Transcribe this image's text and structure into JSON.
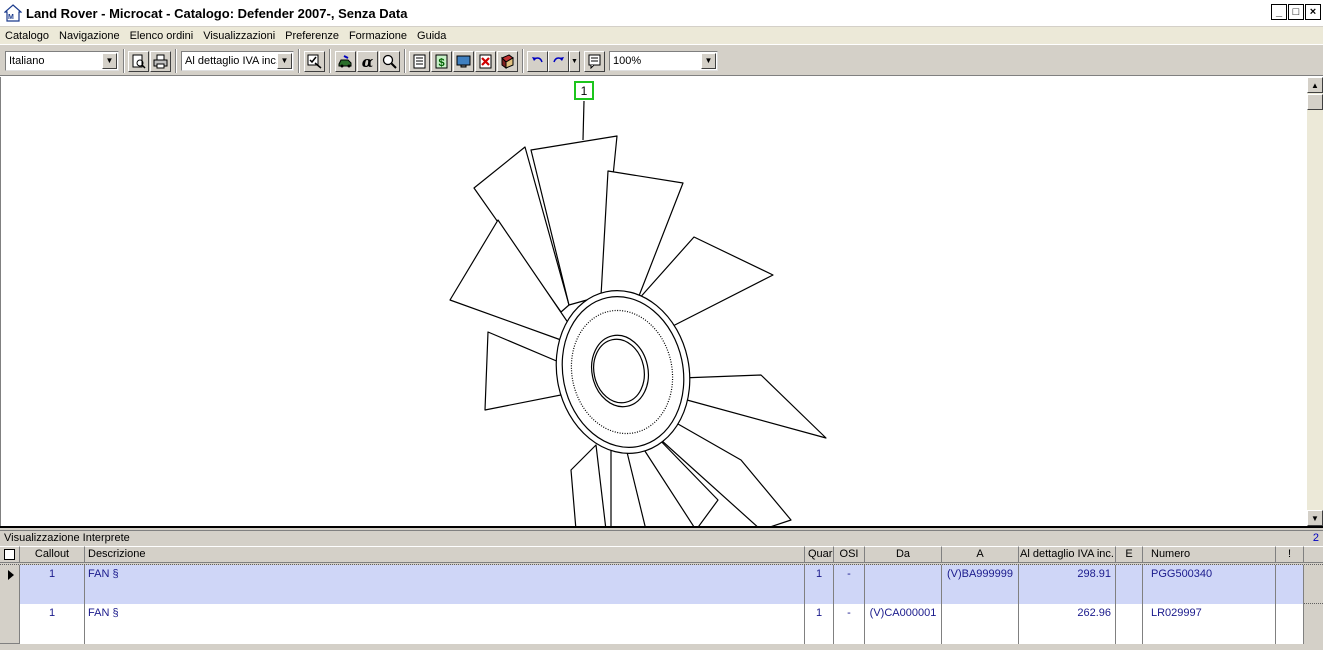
{
  "window": {
    "title": "Land Rover - Microcat - Catalogo: Defender 2007-, Senza Data",
    "minimize": "_",
    "maximize": "□",
    "close": "×"
  },
  "menu": [
    "Catalogo",
    "Navigazione",
    "Elenco ordini",
    "Visualizzazioni",
    "Preferenze",
    "Formazione",
    "Guida"
  ],
  "toolbar": {
    "language": "Italiano",
    "price_mode": "Al dettaglio IVA inc.",
    "zoom": "100%",
    "alpha_symbol": "α"
  },
  "drawing": {
    "callout_label": "1"
  },
  "panel": {
    "title": "Visualizzazione Interprete",
    "count": "2"
  },
  "table": {
    "headers": {
      "callout": "Callout",
      "descrizione": "Descrizione",
      "quantita": "Quar",
      "osi": "OSI",
      "da": "Da",
      "a": "A",
      "prezzo": "Al dettaglio IVA inc.",
      "e": "E",
      "numero": "Numero",
      "flag": "!"
    },
    "rows": [
      {
        "callout": "1",
        "descrizione": "FAN §",
        "quantita": "1",
        "osi": "-",
        "da": "",
        "a": "(V)BA999999",
        "prezzo": "298.91",
        "e": "",
        "numero": "PGG500340",
        "flag": ""
      },
      {
        "callout": "1",
        "descrizione": "FAN §",
        "quantita": "1",
        "osi": "-",
        "da": "(V)CA000001",
        "a": "",
        "prezzo": "262.96",
        "e": "",
        "numero": "LR029997",
        "flag": ""
      }
    ]
  }
}
